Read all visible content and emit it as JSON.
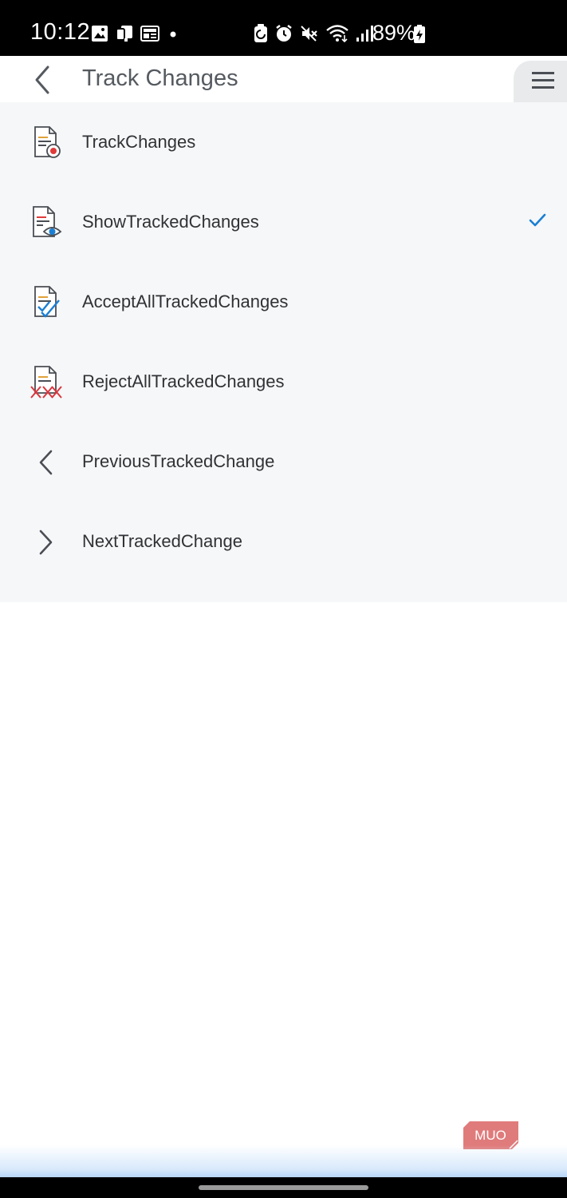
{
  "status_bar": {
    "time": "10:12",
    "battery_percent": "89%",
    "left_icons": [
      "gallery-icon",
      "devices-icon",
      "news-icon",
      "dot-icon"
    ],
    "right_icons": [
      "data-saver-icon",
      "alarm-icon",
      "mute-icon",
      "wifi-icon",
      "signal-icon",
      "battery-charging-icon"
    ]
  },
  "header": {
    "title": "Track Changes",
    "back_icon": "chevron-left-icon",
    "menu_icon": "hamburger-menu-icon"
  },
  "menu": {
    "items": [
      {
        "label": "TrackChanges",
        "icon": "track-changes-icon",
        "checked": false
      },
      {
        "label": "ShowTrackedChanges",
        "icon": "show-tracked-changes-icon",
        "checked": true
      },
      {
        "label": "AcceptAllTrackedChanges",
        "icon": "accept-all-icon",
        "checked": false
      },
      {
        "label": "RejectAllTrackedChanges",
        "icon": "reject-all-icon",
        "checked": false
      },
      {
        "label": "PreviousTrackedChange",
        "icon": "chevron-left-icon",
        "checked": false
      },
      {
        "label": "NextTrackedChange",
        "icon": "chevron-right-icon",
        "checked": false
      }
    ]
  },
  "watermark": {
    "text": "MUO"
  },
  "colors": {
    "accent_blue": "#1a7fd4",
    "reject_red": "#d9363e",
    "record_red": "#e03a3a",
    "panel_bg": "#f6f7f8",
    "watermark_bg": "#e07b7b"
  }
}
